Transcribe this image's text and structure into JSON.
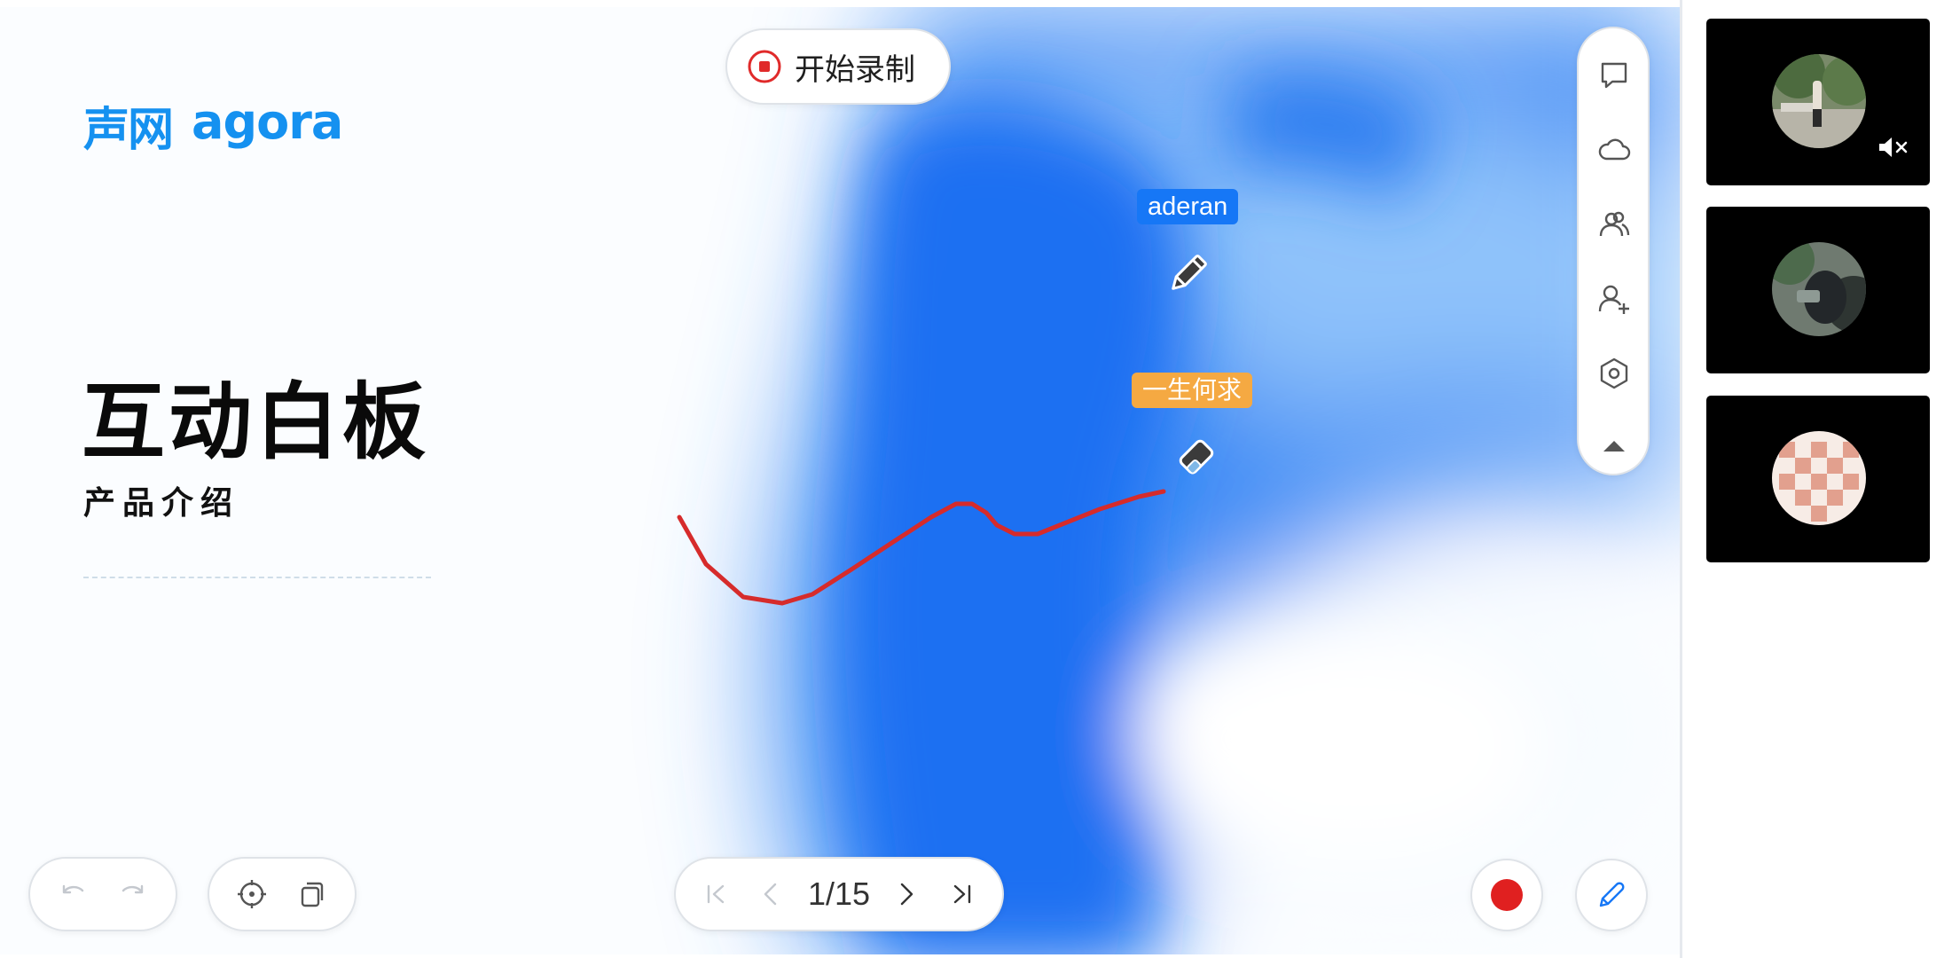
{
  "brand": {
    "name_cn": "声网",
    "name_en": "agora"
  },
  "slide": {
    "title": "互动白板",
    "subtitle": "产品介绍"
  },
  "record": {
    "label": "开始录制"
  },
  "toolbar": {
    "items": [
      {
        "name": "chat",
        "icon": "chat-bubble-icon"
      },
      {
        "name": "cloud",
        "icon": "cloud-icon"
      },
      {
        "name": "users",
        "icon": "users-icon"
      },
      {
        "name": "invite",
        "icon": "add-user-icon"
      },
      {
        "name": "settings",
        "icon": "settings-hexagon-icon"
      },
      {
        "name": "collapse",
        "icon": "triangle-up-icon"
      }
    ]
  },
  "cursors": [
    {
      "user": "aderan",
      "tool": "pencil-icon",
      "color": "#1677f6"
    },
    {
      "user": "一生何求",
      "tool": "eraser-icon",
      "color": "#f5a942"
    }
  ],
  "stroke": {
    "color": "#d62b2b"
  },
  "pager": {
    "current": 1,
    "total": 15,
    "indicator": "1/15"
  },
  "colors": {
    "accent": "#1591f0",
    "record_red": "#e02020",
    "tile_bg": "#000000"
  },
  "participants": [
    {
      "tile": 1,
      "avatar": "photo-outdoor",
      "audio_muted": true
    },
    {
      "tile": 2,
      "avatar": "photo-person",
      "audio_muted": false
    },
    {
      "tile": 3,
      "avatar": "pattern-checker",
      "audio_muted": false
    }
  ]
}
